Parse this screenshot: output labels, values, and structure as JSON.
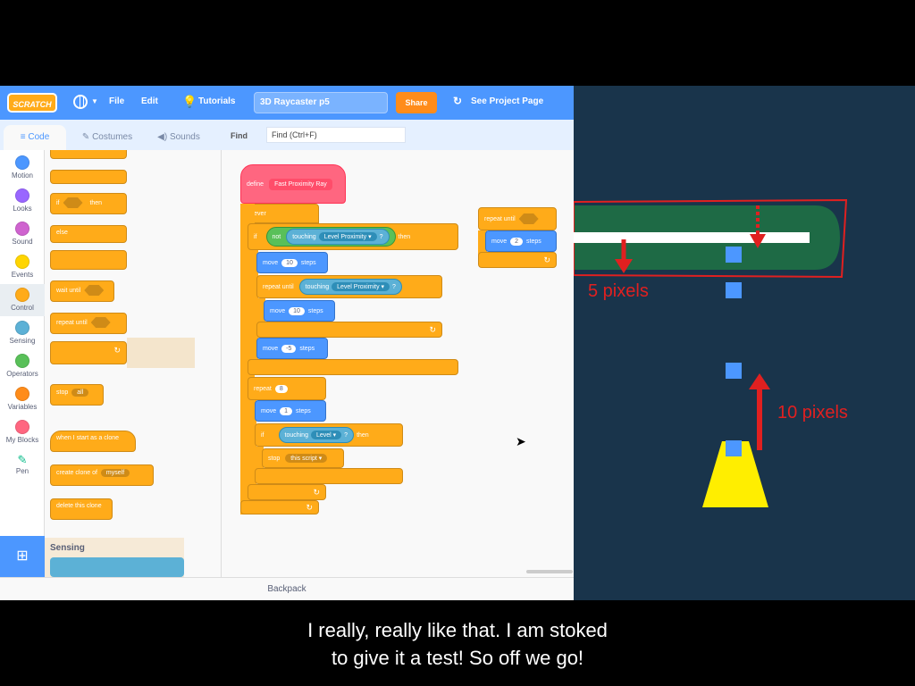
{
  "menubar": {
    "logo": "SCRATCH",
    "file": "File",
    "edit": "Edit",
    "tutorials": "Tutorials",
    "project_title": "3D Raycaster p5",
    "share": "Share",
    "see_project_page": "See Project Page"
  },
  "tabs": {
    "code": "Code",
    "costumes": "Costumes",
    "sounds": "Sounds",
    "find_label": "Find",
    "find_placeholder": "Find (Ctrl+F)"
  },
  "categories": [
    {
      "label": "Motion",
      "color": "#4c97ff"
    },
    {
      "label": "Looks",
      "color": "#9966ff"
    },
    {
      "label": "Sound",
      "color": "#cf63cf"
    },
    {
      "label": "Events",
      "color": "#ffd500"
    },
    {
      "label": "Control",
      "color": "#ffab19"
    },
    {
      "label": "Sensing",
      "color": "#5cb1d6"
    },
    {
      "label": "Operators",
      "color": "#59c059"
    },
    {
      "label": "Variables",
      "color": "#ff8c1a"
    },
    {
      "label": "My Blocks",
      "color": "#ff6680"
    },
    {
      "label": "Pen",
      "color": "#0fbd8c"
    }
  ],
  "palette": {
    "if_then": "if",
    "then": "then",
    "else": "else",
    "wait_until": "wait until",
    "repeat_until": "repeat until",
    "stop": "stop",
    "stop_value": "all",
    "clone_start": "when I start as a clone",
    "create_clone": "create clone of",
    "create_clone_value": "myself",
    "delete_clone": "delete this clone",
    "sensing": "Sensing"
  },
  "script": {
    "define": "define",
    "define_name": "Fast Proximity Ray",
    "forever": "forever",
    "if": "if",
    "not": "not",
    "touching": "touching",
    "level_proximity": "Level Proximity",
    "q": "?",
    "then": "then",
    "move": "move",
    "steps": "steps",
    "move1": "10",
    "repeat_until": "repeat until",
    "move2": "10",
    "move3": "-5",
    "repeat": "repeat",
    "repeat_count": "8",
    "move4": "1",
    "level": "Level",
    "stop": "stop",
    "stop_value": "this script",
    "side_repeat_until": "repeat until",
    "side_move": "2"
  },
  "backpack": "Backpack",
  "stage": {
    "label_5": "5 pixels",
    "label_10": "10 pixels",
    "annotation_color": "#e02020",
    "bg_color": "#19344b",
    "track_color": "#1e6a45",
    "square_color": "#4c97ff",
    "cone_color": "#ffee00"
  },
  "subtitle": {
    "line1": "I really, really like that. I am stoked",
    "line2": "to give it a test! So off we go!"
  }
}
